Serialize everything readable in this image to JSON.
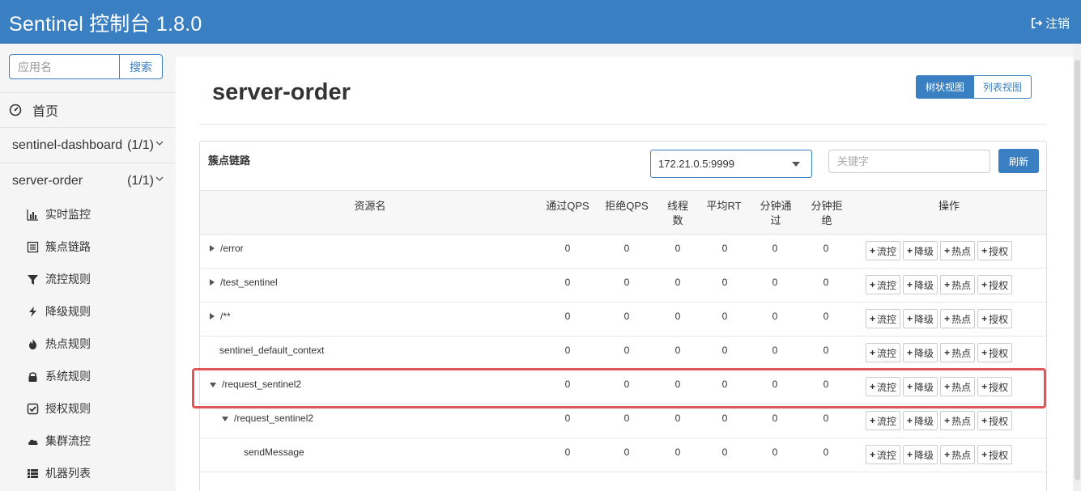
{
  "header": {
    "title": "Sentinel 控制台 1.8.0",
    "logout_label": "注销"
  },
  "sidebar": {
    "search_placeholder": "应用名",
    "search_button": "搜索",
    "home_label": "首页",
    "apps": [
      {
        "name": "sentinel-dashboard",
        "count": "(1/1)"
      },
      {
        "name": "server-order",
        "count": "(1/1)"
      }
    ],
    "items": [
      {
        "label": "实时监控",
        "icon": "bar-chart-icon"
      },
      {
        "label": "簇点链路",
        "icon": "list-icon"
      },
      {
        "label": "流控规则",
        "icon": "filter-icon"
      },
      {
        "label": "降级规则",
        "icon": "flash-icon"
      },
      {
        "label": "热点规则",
        "icon": "fire-icon"
      },
      {
        "label": "系统规则",
        "icon": "lock-icon"
      },
      {
        "label": "授权规则",
        "icon": "check-icon"
      },
      {
        "label": "集群流控",
        "icon": "cloud-icon"
      },
      {
        "label": "机器列表",
        "icon": "th-list-icon"
      }
    ]
  },
  "main": {
    "page_title": "server-order",
    "view_tree": "树状视图",
    "view_list": "列表视图",
    "panel_label": "簇点链路",
    "machine": "172.21.0.5:9999",
    "keyword_placeholder": "关键字",
    "refresh_label": "刷新",
    "columns": {
      "resource": "资源名",
      "pass_qps": "通过QPS",
      "block_qps": "拒绝QPS",
      "thread_line1": "线程",
      "thread_line2": "数",
      "avg_rt": "平均RT",
      "min_pass_line1": "分钟通",
      "min_pass_line2": "过",
      "min_block_line1": "分钟拒",
      "min_block_line2": "绝",
      "ops": "操作"
    },
    "ops": {
      "flow": "流控",
      "degrade": "降级",
      "hot": "热点",
      "auth": "授权"
    },
    "rows": [
      {
        "name": "/error",
        "pass": "0",
        "block": "0",
        "thread": "0",
        "rt": "0",
        "minpass": "0",
        "minblock": "0"
      },
      {
        "name": "/test_sentinel",
        "pass": "0",
        "block": "0",
        "thread": "0",
        "rt": "0",
        "minpass": "0",
        "minblock": "0"
      },
      {
        "name": "/**",
        "pass": "0",
        "block": "0",
        "thread": "0",
        "rt": "0",
        "minpass": "0",
        "minblock": "0"
      },
      {
        "name": "sentinel_default_context",
        "pass": "0",
        "block": "0",
        "thread": "0",
        "rt": "0",
        "minpass": "0",
        "minblock": "0"
      },
      {
        "name": "/request_sentinel2",
        "pass": "0",
        "block": "0",
        "thread": "0",
        "rt": "0",
        "minpass": "0",
        "minblock": "0"
      },
      {
        "name": "/request_sentinel2",
        "pass": "0",
        "block": "0",
        "thread": "0",
        "rt": "0",
        "minpass": "0",
        "minblock": "0"
      },
      {
        "name": "sendMessage",
        "pass": "0",
        "block": "0",
        "thread": "0",
        "rt": "0",
        "minpass": "0",
        "minblock": "0"
      }
    ]
  },
  "colors": {
    "primary": "#3a7fc1",
    "highlight": "#e05555"
  }
}
